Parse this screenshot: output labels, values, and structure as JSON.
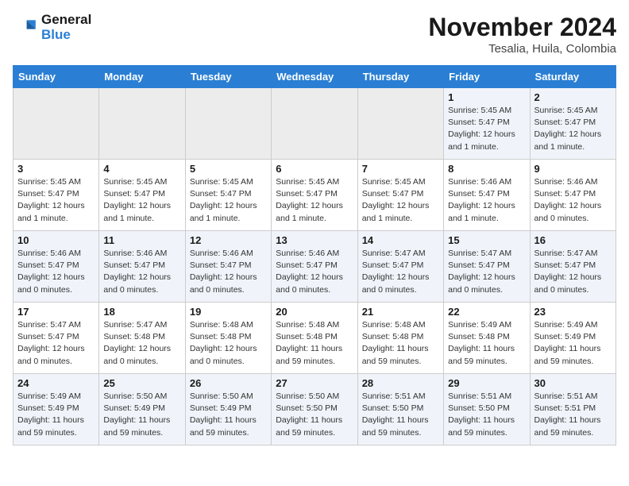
{
  "logo": {
    "line1": "General",
    "line2": "Blue"
  },
  "title": "November 2024",
  "subtitle": "Tesalia, Huila, Colombia",
  "weekdays": [
    "Sunday",
    "Monday",
    "Tuesday",
    "Wednesday",
    "Thursday",
    "Friday",
    "Saturday"
  ],
  "weeks": [
    [
      {
        "day": "",
        "info": ""
      },
      {
        "day": "",
        "info": ""
      },
      {
        "day": "",
        "info": ""
      },
      {
        "day": "",
        "info": ""
      },
      {
        "day": "",
        "info": ""
      },
      {
        "day": "1",
        "info": "Sunrise: 5:45 AM\nSunset: 5:47 PM\nDaylight: 12 hours and 1 minute."
      },
      {
        "day": "2",
        "info": "Sunrise: 5:45 AM\nSunset: 5:47 PM\nDaylight: 12 hours and 1 minute."
      }
    ],
    [
      {
        "day": "3",
        "info": "Sunrise: 5:45 AM\nSunset: 5:47 PM\nDaylight: 12 hours and 1 minute."
      },
      {
        "day": "4",
        "info": "Sunrise: 5:45 AM\nSunset: 5:47 PM\nDaylight: 12 hours and 1 minute."
      },
      {
        "day": "5",
        "info": "Sunrise: 5:45 AM\nSunset: 5:47 PM\nDaylight: 12 hours and 1 minute."
      },
      {
        "day": "6",
        "info": "Sunrise: 5:45 AM\nSunset: 5:47 PM\nDaylight: 12 hours and 1 minute."
      },
      {
        "day": "7",
        "info": "Sunrise: 5:45 AM\nSunset: 5:47 PM\nDaylight: 12 hours and 1 minute."
      },
      {
        "day": "8",
        "info": "Sunrise: 5:46 AM\nSunset: 5:47 PM\nDaylight: 12 hours and 1 minute."
      },
      {
        "day": "9",
        "info": "Sunrise: 5:46 AM\nSunset: 5:47 PM\nDaylight: 12 hours and 0 minutes."
      }
    ],
    [
      {
        "day": "10",
        "info": "Sunrise: 5:46 AM\nSunset: 5:47 PM\nDaylight: 12 hours and 0 minutes."
      },
      {
        "day": "11",
        "info": "Sunrise: 5:46 AM\nSunset: 5:47 PM\nDaylight: 12 hours and 0 minutes."
      },
      {
        "day": "12",
        "info": "Sunrise: 5:46 AM\nSunset: 5:47 PM\nDaylight: 12 hours and 0 minutes."
      },
      {
        "day": "13",
        "info": "Sunrise: 5:46 AM\nSunset: 5:47 PM\nDaylight: 12 hours and 0 minutes."
      },
      {
        "day": "14",
        "info": "Sunrise: 5:47 AM\nSunset: 5:47 PM\nDaylight: 12 hours and 0 minutes."
      },
      {
        "day": "15",
        "info": "Sunrise: 5:47 AM\nSunset: 5:47 PM\nDaylight: 12 hours and 0 minutes."
      },
      {
        "day": "16",
        "info": "Sunrise: 5:47 AM\nSunset: 5:47 PM\nDaylight: 12 hours and 0 minutes."
      }
    ],
    [
      {
        "day": "17",
        "info": "Sunrise: 5:47 AM\nSunset: 5:47 PM\nDaylight: 12 hours and 0 minutes."
      },
      {
        "day": "18",
        "info": "Sunrise: 5:47 AM\nSunset: 5:48 PM\nDaylight: 12 hours and 0 minutes."
      },
      {
        "day": "19",
        "info": "Sunrise: 5:48 AM\nSunset: 5:48 PM\nDaylight: 12 hours and 0 minutes."
      },
      {
        "day": "20",
        "info": "Sunrise: 5:48 AM\nSunset: 5:48 PM\nDaylight: 11 hours and 59 minutes."
      },
      {
        "day": "21",
        "info": "Sunrise: 5:48 AM\nSunset: 5:48 PM\nDaylight: 11 hours and 59 minutes."
      },
      {
        "day": "22",
        "info": "Sunrise: 5:49 AM\nSunset: 5:48 PM\nDaylight: 11 hours and 59 minutes."
      },
      {
        "day": "23",
        "info": "Sunrise: 5:49 AM\nSunset: 5:49 PM\nDaylight: 11 hours and 59 minutes."
      }
    ],
    [
      {
        "day": "24",
        "info": "Sunrise: 5:49 AM\nSunset: 5:49 PM\nDaylight: 11 hours and 59 minutes."
      },
      {
        "day": "25",
        "info": "Sunrise: 5:50 AM\nSunset: 5:49 PM\nDaylight: 11 hours and 59 minutes."
      },
      {
        "day": "26",
        "info": "Sunrise: 5:50 AM\nSunset: 5:49 PM\nDaylight: 11 hours and 59 minutes."
      },
      {
        "day": "27",
        "info": "Sunrise: 5:50 AM\nSunset: 5:50 PM\nDaylight: 11 hours and 59 minutes."
      },
      {
        "day": "28",
        "info": "Sunrise: 5:51 AM\nSunset: 5:50 PM\nDaylight: 11 hours and 59 minutes."
      },
      {
        "day": "29",
        "info": "Sunrise: 5:51 AM\nSunset: 5:50 PM\nDaylight: 11 hours and 59 minutes."
      },
      {
        "day": "30",
        "info": "Sunrise: 5:51 AM\nSunset: 5:51 PM\nDaylight: 11 hours and 59 minutes."
      }
    ]
  ]
}
